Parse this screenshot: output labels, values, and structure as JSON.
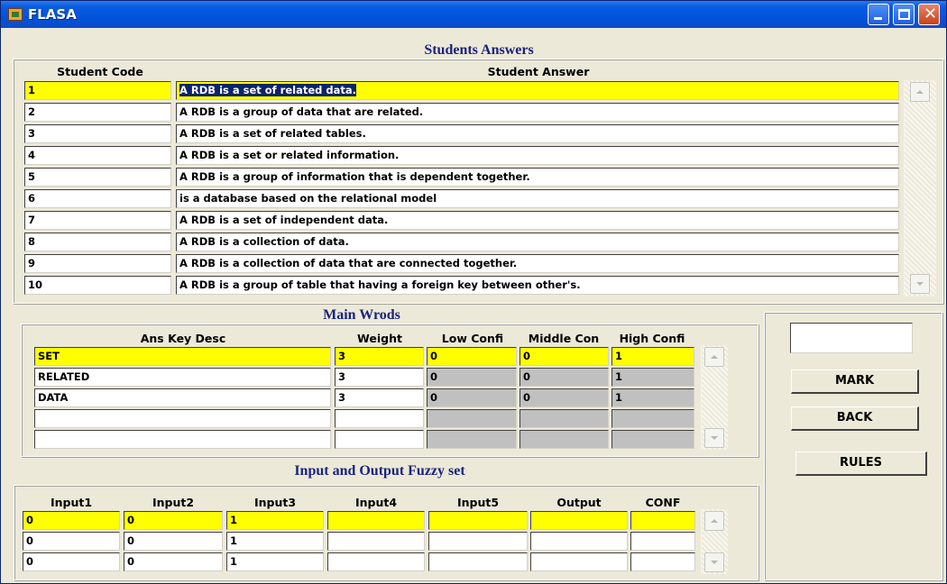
{
  "window": {
    "title": "FLASA"
  },
  "students": {
    "title": "Students Answers",
    "col_code": "Student Code",
    "col_answer": "Student Answer",
    "rows": [
      {
        "code": "1",
        "answer": "A RDB is a set of related data."
      },
      {
        "code": "2",
        "answer": "A RDB is a group of data that are related."
      },
      {
        "code": "3",
        "answer": "A RDB is a set of related tables."
      },
      {
        "code": "4",
        "answer": "A RDB is a set or related information."
      },
      {
        "code": "5",
        "answer": "A RDB is a group of information that is dependent together."
      },
      {
        "code": "6",
        "answer": "is a database based on the relational model"
      },
      {
        "code": "7",
        "answer": "A RDB is a set of independent data."
      },
      {
        "code": "8",
        "answer": "A RDB is a collection of data."
      },
      {
        "code": "9",
        "answer": "A RDB is a collection of data that are connected together."
      },
      {
        "code": "10",
        "answer": "A RDB is a group of table that having a foreign key between other's."
      }
    ]
  },
  "main_words": {
    "title": "Main Wrods",
    "col_desc": "Ans Key Desc",
    "col_weight": "Weight",
    "col_low": "Low Confi",
    "col_mid": "Middle Con",
    "col_high": "High Confi",
    "rows": [
      {
        "desc": "SET",
        "weight": "3",
        "low": "0",
        "mid": "0",
        "high": "1"
      },
      {
        "desc": "RELATED",
        "weight": "3",
        "low": "0",
        "mid": "0",
        "high": "1"
      },
      {
        "desc": "DATA",
        "weight": "3",
        "low": "0",
        "mid": "0",
        "high": "1"
      },
      {
        "desc": "",
        "weight": "",
        "low": "",
        "mid": "",
        "high": ""
      },
      {
        "desc": "",
        "weight": "",
        "low": "",
        "mid": "",
        "high": ""
      }
    ]
  },
  "fuzzy": {
    "title": "Input and Output Fuzzy set",
    "cols": [
      "Input1",
      "Input2",
      "Input3",
      "Input4",
      "Input5",
      "Output",
      "CONF"
    ],
    "rows": [
      [
        "0",
        "0",
        "1",
        "",
        "",
        "",
        ""
      ],
      [
        "0",
        "0",
        "1",
        "",
        "",
        "",
        ""
      ],
      [
        "0",
        "0",
        "1",
        "",
        "",
        "",
        ""
      ]
    ]
  },
  "actions": {
    "result_value": "",
    "mark_label": "MARK",
    "back_label": "BACK",
    "rules_label": "RULES"
  },
  "colors": {
    "highlight": "#ffff00",
    "title_blue": "#1a237e",
    "titlebar": "#0153dc"
  },
  "icons": {
    "app": "flasa-app-icon",
    "minimize": "minimize-icon",
    "maximize": "maximize-icon",
    "close": "close-icon"
  }
}
